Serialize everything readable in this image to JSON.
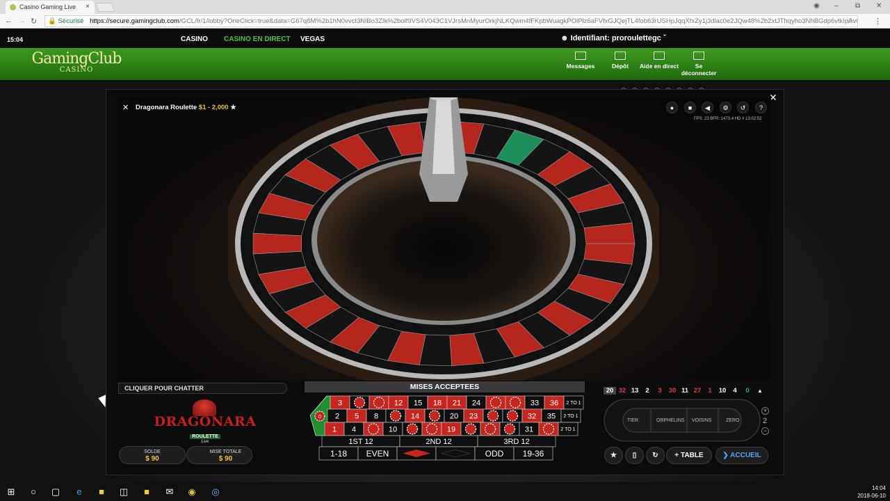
{
  "browser": {
    "tab_title": "Casino Gaming Live",
    "tab_close": "×",
    "url_secure": "Sécurisé",
    "url_host": "https://secure.gamingclub.com",
    "url_path": "/GCL/fr/1/lobby?OneClick=true&data=G67q8M%2b1hN0vvct3NlBo3ZIk%2bolf9VS4V043C1VJrsMnMyurOrkjNLKQwm4fFKpbWuagkPOlPlz6aFVfxGJQejTL4fob63rUSHpJqqXfxZy1j3dlac0e2JQw48%2b2xtJThqyho3NhBGdp6vtkIpAv0vnDdqEq...",
    "back_icon": "arrow-left-icon",
    "accent": "#0b8043"
  },
  "site": {
    "time": "15:04",
    "nav": [
      "CASINO",
      "CASINO EN DIRECT",
      "VEGAS"
    ],
    "active_nav_color": "#4fc53a",
    "user_label": "Identifiant: proroulettegc",
    "logo_main": "GamingClub",
    "logo_sub": "CASINO",
    "account_actions": [
      "Messages",
      "Dépôt",
      "Aide en direct",
      "Se déconnecter"
    ]
  },
  "game": {
    "title": "Dragonara Roulette",
    "limits": "$1 - 2,000",
    "fps_readout": "FPS: 23  BFR: 1473.4  HD  # 13:02:52",
    "chat_label": "CLIQUER POUR CHATTER",
    "brand_name": "DRAGONARA",
    "brand_sub": "ROULETTE",
    "brand_live": "Live",
    "balance_label": "SOLDE",
    "balance_value": "$ 90",
    "total_bet_label": "MISE TOTALE",
    "total_bet_value": "$ 90",
    "bets_header": "MISES ACCEPTEES",
    "history": [
      "20",
      "32",
      "13",
      "2",
      "3",
      "30",
      "11",
      "27",
      "1",
      "10",
      "4",
      "0"
    ],
    "history_colors": [
      "#ffffff",
      "#d83b3b",
      "#ffffff",
      "#ffffff",
      "#d83b3b",
      "#d83b3b",
      "#ffffff",
      "#d83b3b",
      "#d83b3b",
      "#ffffff",
      "#ffffff",
      "#3bb34a"
    ],
    "racetrack_labels": [
      "TIER",
      "ORPHELINS",
      "VOISINS",
      "ZERO"
    ],
    "neighbours": "2",
    "table_label": "TABLE",
    "lobby_label": "ACCUEIL",
    "red": "#c5261f",
    "green": "#1f8f2f"
  },
  "table": {
    "rows": [
      [
        "3",
        "6",
        "9",
        "12",
        "15",
        "18",
        "21",
        "24",
        "27",
        "30",
        "33",
        "36"
      ],
      [
        "2",
        "5",
        "8",
        "11",
        "14",
        "17",
        "20",
        "23",
        "26",
        "29",
        "32",
        "35"
      ],
      [
        "1",
        "4",
        "7",
        "10",
        "13",
        "16",
        "19",
        "22",
        "25",
        "28",
        "31",
        "34"
      ]
    ],
    "red_numbers": [
      1,
      3,
      5,
      7,
      9,
      12,
      14,
      16,
      18,
      19,
      21,
      23,
      25,
      27,
      30,
      32,
      34,
      36
    ],
    "chip_numbers": [
      6,
      9,
      27,
      30,
      11,
      17,
      26,
      29,
      7,
      13,
      16,
      22,
      25,
      28,
      34
    ],
    "columns": [
      "2 TO 1",
      "2 TO 1",
      "2 TO 1"
    ],
    "dozens": [
      "1ST 12",
      "2ND 12",
      "3RD 12"
    ],
    "outside": [
      "1-18",
      "EVEN",
      "",
      "",
      "ODD",
      "19-36"
    ],
    "zero": "0"
  },
  "taskbar": {
    "time": "14:04",
    "date": "2018-06-10"
  }
}
